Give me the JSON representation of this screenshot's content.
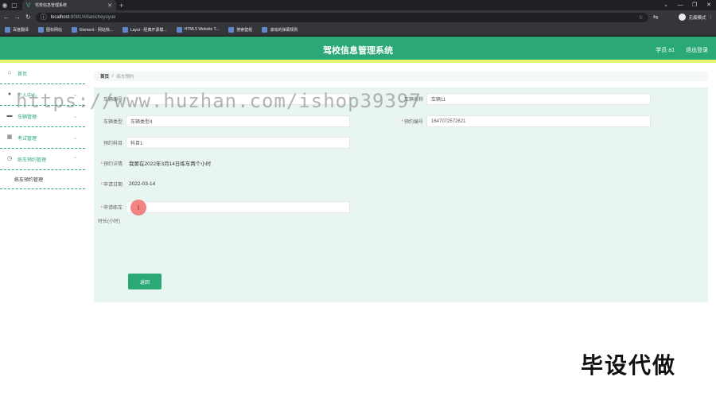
{
  "browser": {
    "tab_title": "驾校信息管理系统",
    "url_host": "localhost",
    "url_rest": ":8081/#/lianicheyuyue",
    "incognito_label": "无痕模式",
    "bookmarks": [
      "百度翻译",
      "图标网站",
      "Element - 网站快...",
      "Layui - 经典开源模...",
      "HTML5 Website T...",
      "搜索壁纸",
      "滚动的弹幕规则"
    ]
  },
  "app": {
    "title": "驾校信息管理系统",
    "user": "学员 a1",
    "logout": "退出登录"
  },
  "sidebar": {
    "items": [
      {
        "label": "首页",
        "icon": "home-icon"
      },
      {
        "label": "个人中心",
        "icon": "user-icon"
      },
      {
        "label": "车辆管理",
        "icon": "car-icon"
      },
      {
        "label": "考试管理",
        "icon": "grid-icon"
      },
      {
        "label": "练车预约管理",
        "icon": "clock-icon"
      }
    ],
    "subitem": "练车预约管理"
  },
  "breadcrumb": {
    "home": "首页",
    "sep": "/",
    "current": "练车预约"
  },
  "form": {
    "car_code_label": "车辆编号",
    "car_name_label": "车辆名称",
    "car_name_value": "车辆11",
    "car_type_label": "车辆类型",
    "car_type_value": "车辆类型4",
    "booking_no_label": "预约编号",
    "booking_no_value": "1647072572621",
    "subject_label": "预约科目",
    "subject_value": "科目1",
    "detail_label": "预约详情",
    "detail_value": "我要在2022年3月14日练车两个小时",
    "date_label": "申请日期",
    "date_value": "2022-03-14",
    "hours_label_1": "申请练车",
    "hours_label_2": "时长(小时)",
    "hours_value": "",
    "back_button": "返回"
  },
  "overlay": {
    "watermark": "https://www.huzhan.com/ishop39397",
    "corner_text": "毕设代做"
  },
  "colors": {
    "primary": "#2aa876",
    "accent_stripe": "#e6f36b"
  }
}
